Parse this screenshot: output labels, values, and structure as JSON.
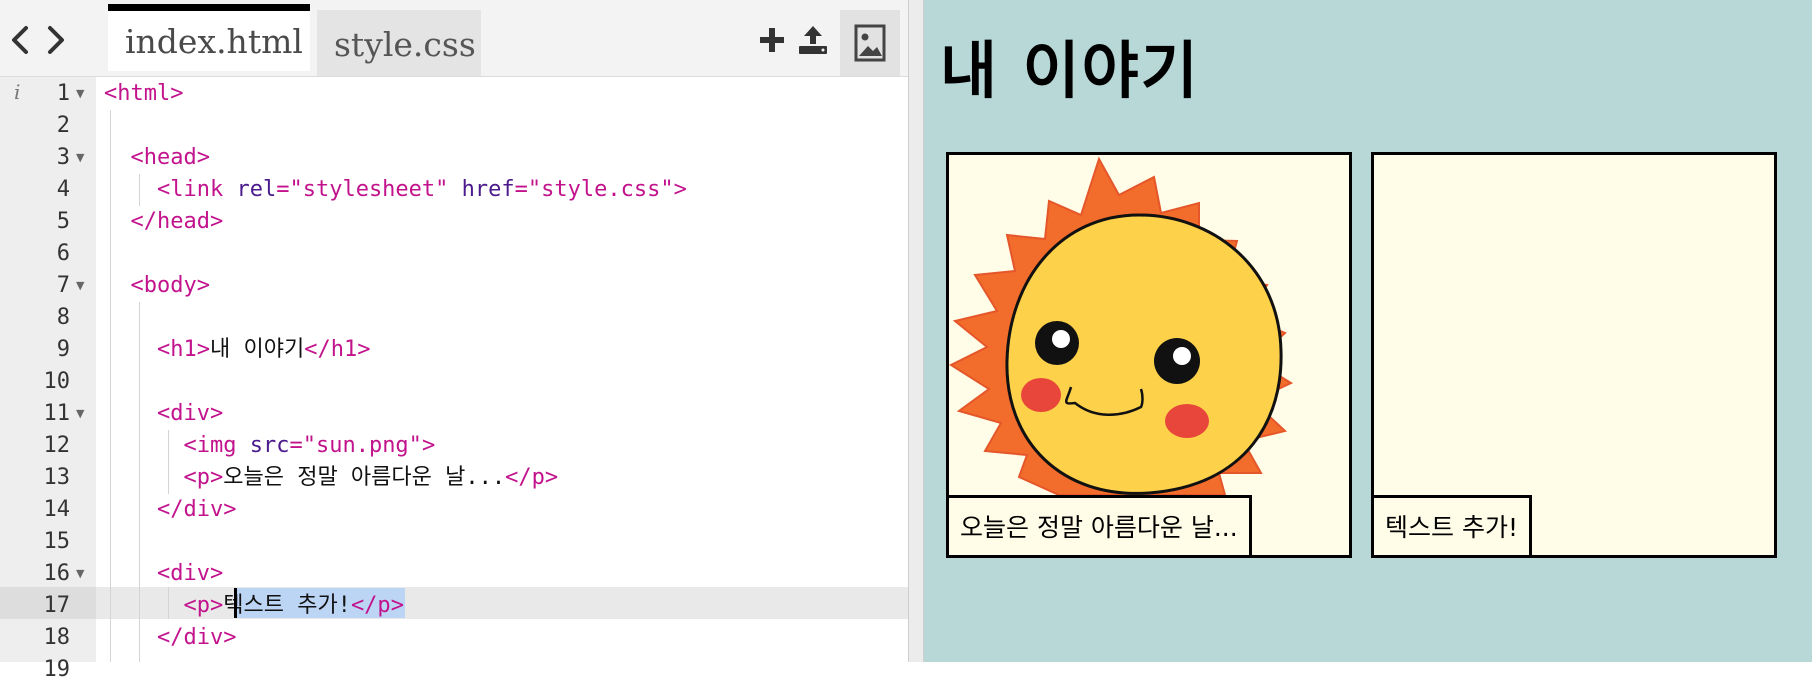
{
  "editor": {
    "tabs": [
      {
        "label": "index.html",
        "active": true
      },
      {
        "label": "style.css",
        "active": false
      }
    ],
    "info_glyph": "i",
    "icons": {
      "back": "chevron-left-icon",
      "forward": "chevron-right-icon",
      "add": "plus-icon",
      "upload": "upload-icon",
      "image": "image-icon"
    },
    "lines": [
      {
        "num": "1",
        "code": "<html>"
      },
      {
        "num": "2",
        "code": ""
      },
      {
        "num": "3",
        "code": "  <head>"
      },
      {
        "num": "4",
        "code": "    <link rel=\"stylesheet\" href=\"style.css\">"
      },
      {
        "num": "5",
        "code": "  </head>"
      },
      {
        "num": "6",
        "code": ""
      },
      {
        "num": "7",
        "code": "  <body>"
      },
      {
        "num": "8",
        "code": ""
      },
      {
        "num": "9",
        "code": "    <h1>내 이야기</h1>"
      },
      {
        "num": "10",
        "code": ""
      },
      {
        "num": "11",
        "code": "    <div>"
      },
      {
        "num": "12",
        "code": "      <img src=\"sun.png\">"
      },
      {
        "num": "13",
        "code": "      <p>오늘은 정말 아름다운 날...</p>"
      },
      {
        "num": "14",
        "code": "    </div>"
      },
      {
        "num": "15",
        "code": ""
      },
      {
        "num": "16",
        "code": "    <div>"
      },
      {
        "num": "17",
        "code": "      <p>텍스트 추가!</p>"
      },
      {
        "num": "18",
        "code": "    </div>"
      },
      {
        "num": "19",
        "code": ""
      }
    ],
    "colors": {
      "tag": "#c2138d",
      "attribute": "#4b1a8c",
      "selection": "#bcd5f5"
    }
  },
  "preview": {
    "title": "내 이야기",
    "background": "#b8d8d8",
    "panels": [
      {
        "image": "sun-illustration",
        "caption": "오늘은 정말 아름다운 날..."
      },
      {
        "image": "",
        "caption": "텍스트 추가!"
      }
    ]
  }
}
